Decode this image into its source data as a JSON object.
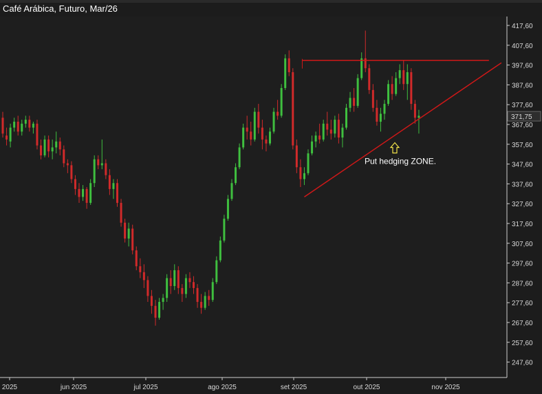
{
  "title": "Café Arábica, Futuro, Mar/26",
  "colors": {
    "background": "#1c1c1c",
    "up": "#3fbf3f",
    "down": "#d12a2a",
    "wick": "#9a9a9a",
    "trendline": "#d01818",
    "axis": "#cfcfcf",
    "price_label_bg": "#2d2d2d",
    "annotation_arrow": "#f2e34a"
  },
  "chart_data": {
    "type": "candlestick",
    "title": "Café Arábica, Futuro, Mar/26",
    "xlabel": "",
    "ylabel": "",
    "ylim": [
      236.0,
      422.0
    ],
    "y_ticks": [
      "417,60",
      "407,60",
      "397,60",
      "387,60",
      "377,60",
      "367,60",
      "357,60",
      "347,60",
      "337,60",
      "327,60",
      "317,60",
      "307,60",
      "297,60",
      "287,60",
      "277,60",
      "267,60",
      "257,60",
      "247,60"
    ],
    "x_ticks": [
      "2025",
      "jun 2025",
      "jul 2025",
      "ago 2025",
      "set 2025",
      "out 2025",
      "nov 2025"
    ],
    "last_price": "371,75",
    "grid": false,
    "series": [
      {
        "values": [
          [
            371,
            374,
            361,
            363
          ],
          [
            362,
            366,
            357,
            360
          ],
          [
            359,
            368,
            356,
            366
          ],
          [
            366,
            371,
            364,
            369
          ],
          [
            369,
            372,
            362,
            364
          ],
          [
            364,
            370,
            362,
            368
          ],
          [
            368,
            372,
            366,
            370
          ],
          [
            370,
            372,
            364,
            366
          ],
          [
            366,
            369,
            363,
            368
          ],
          [
            368,
            370,
            355,
            357
          ],
          [
            357,
            360,
            350,
            352
          ],
          [
            352,
            362,
            351,
            360
          ],
          [
            360,
            362,
            351,
            354
          ],
          [
            354,
            360,
            350,
            356
          ],
          [
            356,
            364,
            353,
            359
          ],
          [
            359,
            361,
            352,
            355
          ],
          [
            355,
            357,
            346,
            348
          ],
          [
            348,
            350,
            343,
            347
          ],
          [
            347,
            349,
            338,
            340
          ],
          [
            340,
            342,
            332,
            335
          ],
          [
            335,
            338,
            328,
            331
          ],
          [
            331,
            337,
            329,
            335
          ],
          [
            335,
            336,
            325,
            328
          ],
          [
            328,
            340,
            327,
            338
          ],
          [
            338,
            352,
            336,
            350
          ],
          [
            350,
            352,
            345,
            347
          ],
          [
            347,
            360,
            345,
            348
          ],
          [
            348,
            350,
            340,
            342
          ],
          [
            342,
            345,
            332,
            335
          ],
          [
            335,
            340,
            330,
            338
          ],
          [
            338,
            340,
            326,
            328
          ],
          [
            328,
            330,
            316,
            318
          ],
          [
            318,
            320,
            308,
            310
          ],
          [
            310,
            318,
            306,
            315
          ],
          [
            315,
            317,
            302,
            304
          ],
          [
            304,
            306,
            294,
            296
          ],
          [
            296,
            300,
            290,
            293
          ],
          [
            293,
            297,
            285,
            289
          ],
          [
            289,
            291,
            278,
            281
          ],
          [
            281,
            284,
            272,
            276
          ],
          [
            276,
            279,
            266,
            270
          ],
          [
            270,
            280,
            269,
            278
          ],
          [
            278,
            282,
            274,
            280
          ],
          [
            280,
            292,
            278,
            290
          ],
          [
            290,
            294,
            282,
            286
          ],
          [
            286,
            297,
            284,
            294
          ],
          [
            294,
            296,
            282,
            285
          ],
          [
            285,
            287,
            278,
            282
          ],
          [
            282,
            292,
            280,
            290
          ],
          [
            290,
            293,
            285,
            288
          ],
          [
            288,
            291,
            282,
            285
          ],
          [
            285,
            287,
            275,
            278
          ],
          [
            278,
            282,
            272,
            275
          ],
          [
            275,
            283,
            274,
            281
          ],
          [
            281,
            284,
            276,
            279
          ],
          [
            279,
            290,
            278,
            288
          ],
          [
            288,
            301,
            287,
            299
          ],
          [
            299,
            311,
            298,
            309
          ],
          [
            309,
            322,
            308,
            320
          ],
          [
            320,
            332,
            319,
            330
          ],
          [
            330,
            340,
            329,
            338
          ],
          [
            338,
            348,
            337,
            346
          ],
          [
            346,
            358,
            345,
            356
          ],
          [
            356,
            368,
            355,
            366
          ],
          [
            366,
            372,
            360,
            364
          ],
          [
            364,
            369,
            357,
            360
          ],
          [
            360,
            376,
            359,
            374
          ],
          [
            374,
            378,
            363,
            366
          ],
          [
            366,
            370,
            355,
            360
          ],
          [
            360,
            362,
            354,
            358
          ],
          [
            358,
            366,
            357,
            364
          ],
          [
            364,
            376,
            363,
            374
          ],
          [
            374,
            380,
            370,
            372
          ],
          [
            372,
            388,
            371,
            386
          ],
          [
            386,
            403,
            385,
            401
          ],
          [
            401,
            405,
            392,
            394
          ],
          [
            394,
            396,
            355,
            357
          ],
          [
            357,
            360,
            343,
            346
          ],
          [
            346,
            350,
            336,
            340
          ],
          [
            340,
            346,
            337,
            343
          ],
          [
            343,
            355,
            342,
            353
          ],
          [
            353,
            362,
            352,
            359
          ],
          [
            359,
            364,
            356,
            362
          ],
          [
            362,
            368,
            358,
            360
          ],
          [
            360,
            370,
            359,
            368
          ],
          [
            368,
            374,
            362,
            365
          ],
          [
            365,
            370,
            360,
            363
          ],
          [
            363,
            372,
            361,
            370
          ],
          [
            370,
            373,
            358,
            361
          ],
          [
            361,
            368,
            356,
            366
          ],
          [
            366,
            378,
            365,
            376
          ],
          [
            376,
            384,
            374,
            381
          ],
          [
            381,
            386,
            374,
            377
          ],
          [
            377,
            393,
            376,
            391
          ],
          [
            391,
            404,
            390,
            401
          ],
          [
            401,
            415,
            394,
            396
          ],
          [
            396,
            398,
            383,
            385
          ],
          [
            385,
            388,
            374,
            376
          ],
          [
            376,
            380,
            367,
            369
          ],
          [
            369,
            376,
            364,
            373
          ],
          [
            373,
            380,
            370,
            378
          ],
          [
            378,
            390,
            377,
            388
          ],
          [
            388,
            392,
            380,
            383
          ],
          [
            383,
            394,
            382,
            391
          ],
          [
            391,
            398,
            388,
            395
          ],
          [
            395,
            400,
            385,
            388
          ],
          [
            388,
            398,
            380,
            394
          ],
          [
            394,
            396,
            375,
            378
          ],
          [
            378,
            380,
            368,
            371
          ],
          [
            371,
            375,
            363,
            372
          ]
        ]
      }
    ]
  },
  "annotations": {
    "hedging_label": "Put hedging ZONE.",
    "resistance_level": 400.0,
    "support_line": {
      "x0_index": 79,
      "y0": 331.0,
      "x1_index": 118,
      "y1": 389.0
    },
    "arrow_at_index": 100,
    "arrow_value": 357.0
  }
}
